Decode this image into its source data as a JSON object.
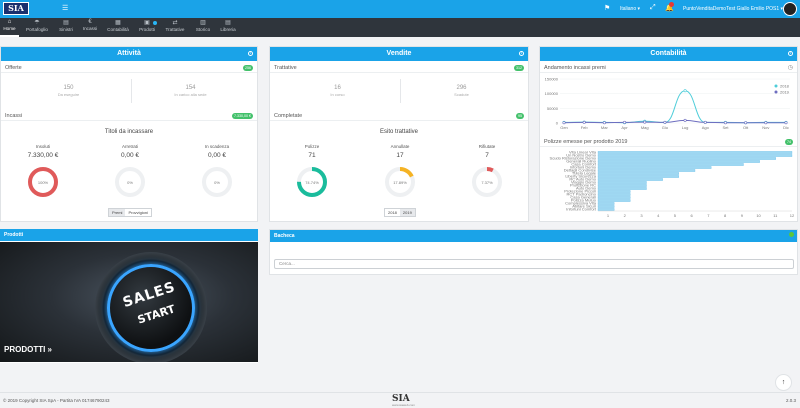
{
  "topbar": {
    "logo": "SIA",
    "language": "Italiano ▾",
    "user": "PuntoVenditaDemoTest Giallo Emilio POS1 ▾",
    "icons": [
      "bars-icon",
      "flag-icon",
      "expand-icon",
      "bell-icon"
    ]
  },
  "nav": {
    "items": [
      {
        "label": "Home",
        "icon": "⌂",
        "active": true
      },
      {
        "label": "Portafoglio",
        "icon": "☂"
      },
      {
        "label": "Sinistri",
        "icon": "▤"
      },
      {
        "label": "Incassi",
        "icon": "€"
      },
      {
        "label": "Contabilità",
        "icon": "▦"
      },
      {
        "label": "Prodotti",
        "icon": "▣"
      },
      {
        "label": "Trattative",
        "icon": "⇄"
      },
      {
        "label": "Storico",
        "icon": "▥"
      },
      {
        "label": "Libreria",
        "icon": "▤"
      }
    ]
  },
  "attivita": {
    "title": "Attività",
    "offerte": {
      "label": "Offerte",
      "badge": "256",
      "in_vigore": "150",
      "in_vigore_label": "Da eseguire",
      "in_carico": "154",
      "in_carico_label": "In carico alla sede"
    },
    "incassi": {
      "label": "Incassi",
      "badge": "7.330,00 €",
      "title": "Titoli da incassare",
      "cols": [
        {
          "label": "Insoluti",
          "value": "7.330,00 €",
          "pct": "100%",
          "pct_value": 100,
          "color": "#e05a5a"
        },
        {
          "label": "Arretrati",
          "value": "0,00 €",
          "pct": "0%",
          "pct_value": 0,
          "color": "#e05a5a"
        },
        {
          "label": "In scadenza",
          "value": "0,00 €",
          "pct": "0%",
          "pct_value": 0,
          "color": "#e05a5a"
        }
      ],
      "buttons": [
        "Premi",
        "Provvigioni"
      ]
    }
  },
  "vendite": {
    "title": "Vendite",
    "trattative": {
      "label": "Trattative",
      "badge": "312",
      "in_corso": "16",
      "in_corso_label": "In corso",
      "scadute": "296",
      "scadute_label": "Scadute"
    },
    "completate": {
      "label": "Completate",
      "badge": "95",
      "title": "Esito trattative",
      "cols": [
        {
          "label": "Polizze",
          "value": "71",
          "pct": "74.74%",
          "pct_value": 74.74,
          "color": "#1abc9c"
        },
        {
          "label": "Annullate",
          "value": "17",
          "pct": "17.89%",
          "pct_value": 17.89,
          "color": "#f5b324"
        },
        {
          "label": "Rifiutate",
          "value": "7",
          "pct": "7.37%",
          "pct_value": 7.37,
          "color": "#e05a5a"
        }
      ],
      "years": [
        "2018",
        "2019"
      ]
    }
  },
  "contabilita": {
    "title": "Contabilità",
    "andamento_label": "Andamento incassi premi",
    "polizze_label": "Polizze emesse per prodotto 2019",
    "polizze_badge": "74"
  },
  "chart_data": [
    {
      "type": "line",
      "title": "Andamento incassi premi",
      "categories": [
        "Gen",
        "Feb",
        "Mar",
        "Apr",
        "Mag",
        "Giu",
        "Lug",
        "Ago",
        "Set",
        "Ott",
        "Nov",
        "Dic"
      ],
      "yticks": [
        "0",
        "50000",
        "100000",
        "150000"
      ],
      "ylim": [
        0,
        150000
      ],
      "series": [
        {
          "name": "2018",
          "color": "#4ecdd9",
          "values": [
            2000,
            3000,
            2000,
            1000,
            6000,
            2000,
            110000,
            2000,
            2000,
            1000,
            2000,
            2000
          ]
        },
        {
          "name": "2019",
          "color": "#6e6ec0",
          "values": [
            1000,
            2000,
            1000,
            2000,
            3000,
            2000,
            9000,
            2000,
            1000,
            1000,
            1000,
            1000
          ]
        }
      ],
      "legend": "top-right"
    },
    {
      "type": "bar",
      "orientation": "horizontal",
      "title": "Polizze emesse per prodotto 2019",
      "categories": [
        "Vita Linear Vita",
        "Un Nostro Demo",
        "Scudo Ristorazione Demo",
        "Generali Ruolino",
        "Casa Comfort",
        "Infortuni Demo",
        "Dettagli Condivise",
        "Tutela Legale",
        "Liberty Sicurezza",
        "RC Auto Demo",
        "Viaggio Demo",
        "Protezione RC",
        "Auto Demo",
        "Protezione Piccoli",
        "RCT Padroncino",
        "Casa Generali",
        "Polizza Mutuo",
        "Complessiva Vita",
        "Abitare Sicuri",
        "Infortuni Comfort"
      ],
      "values": [
        12,
        12,
        11,
        10,
        9,
        7,
        6,
        5,
        5,
        4,
        3,
        3,
        3,
        2,
        2,
        2,
        2,
        1,
        1,
        1
      ],
      "xticks": [
        "1",
        "2",
        "3",
        "4",
        "5",
        "6",
        "7",
        "8",
        "9",
        "10",
        "11",
        "12"
      ],
      "xlim": [
        1,
        12
      ]
    }
  ],
  "prodotti": {
    "title": "Prodotti",
    "link": "PRODOTTI »",
    "knob_line1": "SALES",
    "knob_line2": "START"
  },
  "bacheca": {
    "title": "Bacheca",
    "search_placeholder": "Cerca..."
  },
  "footer": {
    "copyright": "© 2019 Copyright SIA SpA - Partita IVA 01746790243",
    "brand": "SIA",
    "brand_sub": "www.siaweb.com",
    "version": "2.0.3"
  }
}
